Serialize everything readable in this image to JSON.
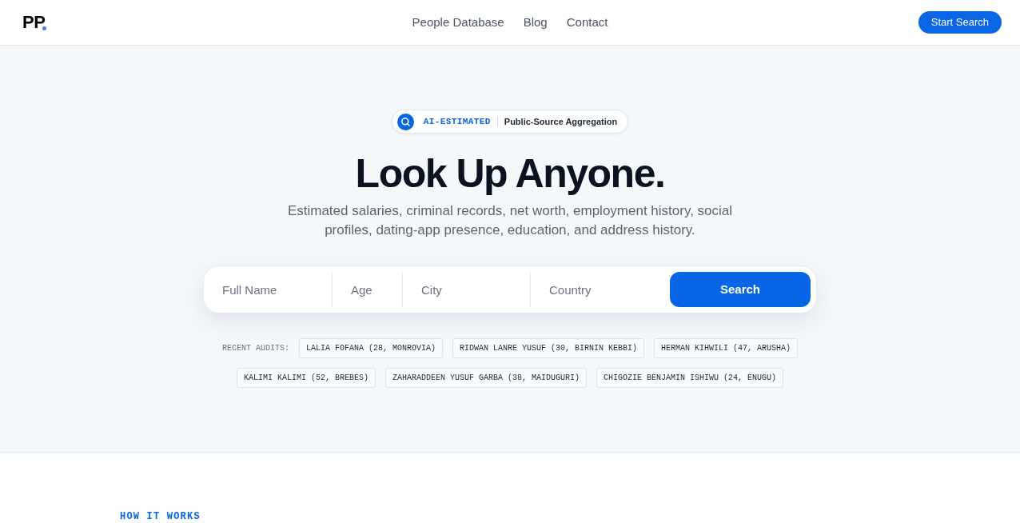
{
  "header": {
    "logo": "PP",
    "nav": [
      {
        "label": "People Database"
      },
      {
        "label": "Blog"
      },
      {
        "label": "Contact"
      }
    ],
    "cta": "Start Search"
  },
  "hero": {
    "badge": {
      "tag": "AI-ESTIMATED",
      "text": "Public-Source Aggregation"
    },
    "title": "Look Up Anyone.",
    "subtitle": "Estimated salaries, criminal records, net worth, employment history, social profiles, dating-app presence, education, and address history.",
    "search": {
      "fields": [
        {
          "placeholder": "Full Name"
        },
        {
          "placeholder": "Age"
        },
        {
          "placeholder": "City"
        },
        {
          "placeholder": "Country"
        }
      ],
      "button": "Search"
    },
    "recent": {
      "label": "RECENT AUDITS:",
      "items": [
        "LALIA FOFANA (28, MONROVIA)",
        "RIDWAN LANRE YUSUF (30, BIRNIN KEBBI)",
        "HERMAN KIHWILI (47, ARUSHA)",
        "KALIMI KALIMI (52, BREBES)",
        "ZAHARADDEEN YUSUF GARBA (38, MAIDUGURI)",
        "CHIGOZIE BENJAMIN ISHIWU (24, ENUGU)"
      ]
    }
  },
  "how_it_works": {
    "eyebrow": "HOW IT WORKS"
  }
}
